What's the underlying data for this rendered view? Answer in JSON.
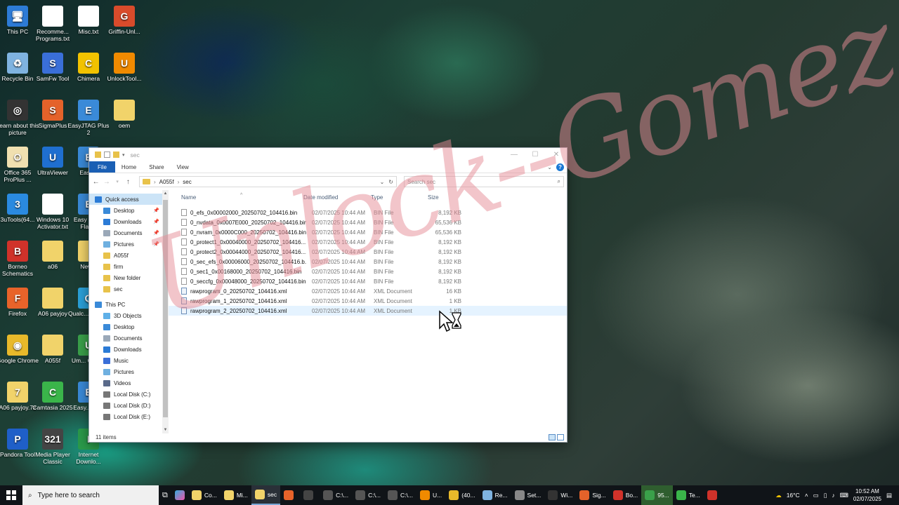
{
  "desktop": {
    "icons": [
      {
        "label": "This PC",
        "color": "#2d7bd6",
        "glyph": "🖥"
      },
      {
        "label": "Recomme... Programs.txt",
        "color": "#ffffff",
        "glyph": ""
      },
      {
        "label": "Misc.txt",
        "color": "#ffffff",
        "glyph": ""
      },
      {
        "label": "Griffin-Unl...",
        "color": "#d94b2b",
        "glyph": "G"
      },
      {
        "label": "Recycle Bin",
        "color": "#7fb3e0",
        "glyph": "♻"
      },
      {
        "label": "SamFw Tool",
        "color": "#3a6fd8",
        "glyph": "S"
      },
      {
        "label": "Chimera",
        "color": "#f2c200",
        "glyph": "C"
      },
      {
        "label": "UnlockTool...",
        "color": "#f08a00",
        "glyph": "U"
      },
      {
        "label": "Learn about this picture",
        "color": "#333333",
        "glyph": "◎"
      },
      {
        "label": "SigmaPlus",
        "color": "#e4622a",
        "glyph": "S"
      },
      {
        "label": "EasyJTAG Plus 2",
        "color": "#3a8ad8",
        "glyph": "E"
      },
      {
        "label": "oem",
        "color": "#f1d36a",
        "glyph": ""
      },
      {
        "label": "Office 365 ProPlus ...",
        "color": "#f0e0b0",
        "glyph": "O"
      },
      {
        "label": "UltraViewer",
        "color": "#1f6fd0",
        "glyph": "U"
      },
      {
        "label": "Easy...",
        "color": "#3a8ad8",
        "glyph": "E"
      },
      {
        "label": "3uTools(64...",
        "color": "#2a8ae0",
        "glyph": "3"
      },
      {
        "label": "Windows 10 Activator.txt",
        "color": "#ffffff",
        "glyph": ""
      },
      {
        "label": "Easy JTAG Flas...",
        "color": "#3a8ad8",
        "glyph": "E"
      },
      {
        "label": "Borneo Schematics",
        "color": "#d0322a",
        "glyph": "B"
      },
      {
        "label": "a06",
        "color": "#f1d36a",
        "glyph": ""
      },
      {
        "label": "New...",
        "color": "#f1d36a",
        "glyph": ""
      },
      {
        "label": "Firefox",
        "color": "#e8632a",
        "glyph": "F"
      },
      {
        "label": "A06 payjoy",
        "color": "#f1d36a",
        "glyph": ""
      },
      {
        "label": "Qualc... pro.e...",
        "color": "#2aa0d8",
        "glyph": "Q"
      },
      {
        "label": "Google Chrome",
        "color": "#e8b92a",
        "glyph": "◉"
      },
      {
        "label": "A055f",
        "color": "#f1d36a",
        "glyph": ""
      },
      {
        "label": "Um... Chro...",
        "color": "#3aa04a",
        "glyph": "U"
      },
      {
        "label": "A06 payjoy.7z",
        "color": "#f1d36a",
        "glyph": "7"
      },
      {
        "label": "Camtasia 2025",
        "color": "#3ab54a",
        "glyph": "C"
      },
      {
        "label": "Easy... To...",
        "color": "#3a8ad8",
        "glyph": "E"
      },
      {
        "label": "Pandora Tool",
        "color": "#1f5fc8",
        "glyph": "P"
      },
      {
        "label": "Media Player Classic",
        "color": "#444444",
        "glyph": "321"
      },
      {
        "label": "Internet Downlo...",
        "color": "#2a9a4a",
        "glyph": "I"
      }
    ]
  },
  "explorer": {
    "title": "sec",
    "ribbon": {
      "file": "File",
      "home": "Home",
      "share": "Share",
      "view": "View"
    },
    "address": {
      "crumb1": "A055f",
      "crumb2": "sec",
      "sep": "›"
    },
    "search_placeholder": "Search sec",
    "nav": {
      "quick_access": "Quick access",
      "qa_items": [
        "Desktop",
        "Downloads",
        "Documents",
        "Pictures",
        "A055f",
        "firm",
        "New folder",
        "sec"
      ],
      "this_pc": "This PC",
      "pc_items": [
        "3D Objects",
        "Desktop",
        "Documents",
        "Downloads",
        "Music",
        "Pictures",
        "Videos",
        "Local Disk (C:)",
        "Local Disk (D:)",
        "Local Disk (E:)"
      ]
    },
    "columns": {
      "name": "Name",
      "date": "Date modified",
      "type": "Type",
      "size": "Size"
    },
    "files": [
      {
        "name": "0_efs_0x00002000_20250702_104416.bin",
        "date": "02/07/2025 10:44 AM",
        "type": "BIN File",
        "size": "8,192 KB"
      },
      {
        "name": "0_nvdata_0x0007E000_20250702_104416.bin",
        "date": "02/07/2025 10:44 AM",
        "type": "BIN File",
        "size": "65,536 KB"
      },
      {
        "name": "0_nvram_0x0000C000_20250702_104416.bin",
        "date": "02/07/2025 10:44 AM",
        "type": "BIN File",
        "size": "65,536 KB"
      },
      {
        "name": "0_protect1_0x00040000_20250702_104416....",
        "date": "02/07/2025 10:44 AM",
        "type": "BIN File",
        "size": "8,192 KB"
      },
      {
        "name": "0_protect2_0x00044000_20250702_104416....",
        "date": "02/07/2025 10:44 AM",
        "type": "BIN File",
        "size": "8,192 KB"
      },
      {
        "name": "0_sec_efs_0x00006000_20250702_104416.b...",
        "date": "02/07/2025 10:44 AM",
        "type": "BIN File",
        "size": "8,192 KB"
      },
      {
        "name": "0_sec1_0x00168000_20250702_104416.bin",
        "date": "02/07/2025 10:44 AM",
        "type": "BIN File",
        "size": "8,192 KB"
      },
      {
        "name": "0_seccfg_0x00048000_20250702_104416.bin",
        "date": "02/07/2025 10:44 AM",
        "type": "BIN File",
        "size": "8,192 KB"
      },
      {
        "name": "rawprogram_0_20250702_104416.xml",
        "date": "02/07/2025 10:44 AM",
        "type": "XML Document",
        "size": "16 KB"
      },
      {
        "name": "rawprogram_1_20250702_104416.xml",
        "date": "02/07/2025 10:44 AM",
        "type": "XML Document",
        "size": "1 KB"
      },
      {
        "name": "rawprogram_2_20250702_104416.xml",
        "date": "02/07/2025 10:44 AM",
        "type": "XML Document",
        "size": "1 KB"
      }
    ],
    "status": "11 items"
  },
  "watermark": "Unlock--Gomez",
  "taskbar": {
    "search_placeholder": "Type here to search",
    "items": [
      {
        "label": "Co...",
        "color": "#f1d36a"
      },
      {
        "label": "Mi...",
        "color": "#f1d36a"
      },
      {
        "label": "sec",
        "color": "#f1d36a"
      },
      {
        "label": "",
        "color": "#e8632a"
      },
      {
        "label": "",
        "color": "#444444"
      },
      {
        "label": "C:\\...",
        "color": "#555555"
      },
      {
        "label": "C:\\...",
        "color": "#555555"
      },
      {
        "label": "C:\\...",
        "color": "#555555"
      },
      {
        "label": "U...",
        "color": "#f08a00"
      },
      {
        "label": "(40...",
        "color": "#e8b92a"
      },
      {
        "label": "Re...",
        "color": "#7fb3e0"
      },
      {
        "label": "Set...",
        "color": "#888888"
      },
      {
        "label": "Wi...",
        "color": "#333333"
      },
      {
        "label": "Sig...",
        "color": "#e4622a"
      },
      {
        "label": "Bo...",
        "color": "#d0322a"
      },
      {
        "label": "95...",
        "color": "#3aa04a"
      },
      {
        "label": "Te...",
        "color": "#3ab54a"
      },
      {
        "label": "",
        "color": "#d0322a"
      }
    ],
    "weather": "16°C",
    "time": "10:52 AM",
    "date": "02/07/2025"
  }
}
